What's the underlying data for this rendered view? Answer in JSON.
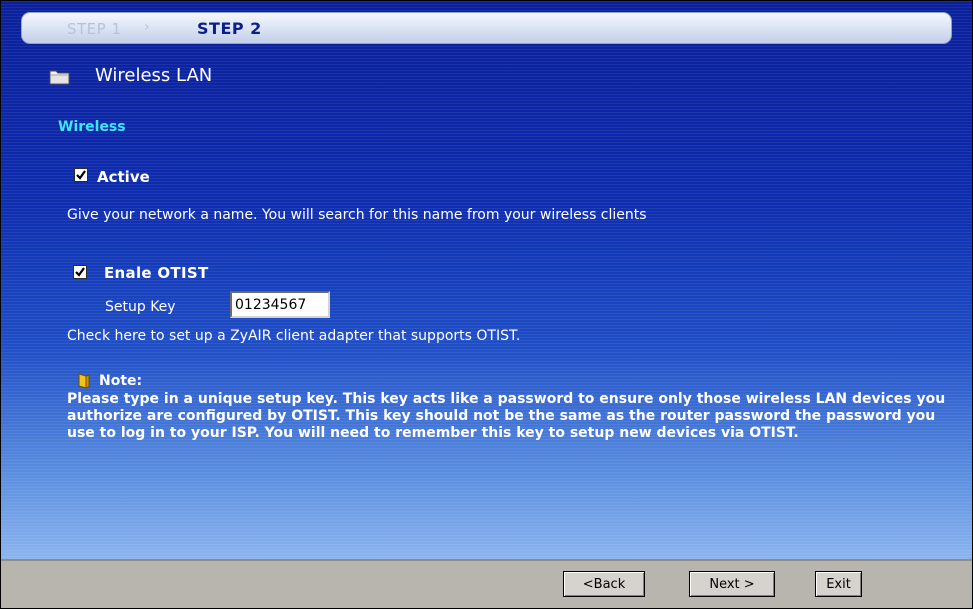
{
  "steps": {
    "step1": "STEP 1",
    "arrow": "›",
    "step2": "STEP 2"
  },
  "header": {
    "title": "Wireless LAN",
    "icon": "folder-icon"
  },
  "section": {
    "title": "Wireless"
  },
  "active": {
    "label": "Active",
    "checked": true,
    "description": "Give your network a name. You will search for this name from your wireless clients"
  },
  "otist": {
    "label": "Enale OTIST",
    "checked": true,
    "setup_key_label": "Setup Key",
    "setup_key_value": "01234567",
    "description": "Check here to set up a ZyAIR client adapter that supports OTIST."
  },
  "note": {
    "icon": "note-icon",
    "title": "Note:",
    "body": "Please type in a unique setup key. This key acts like a password to ensure only those wireless LAN devices you authorize are configured by OTIST. This key should not be the same as the router password the password you use to log in to your ISP. You will need to remember this key to setup new devices via OTIST."
  },
  "footer": {
    "back_label": "<Back",
    "next_label": "Next >",
    "exit_label": "Exit"
  },
  "colors": {
    "background_top": "#0b1f9a",
    "background_bottom": "#8cb4ef",
    "section_accent": "#3fe6ff",
    "footer": "#b8b4ae"
  }
}
